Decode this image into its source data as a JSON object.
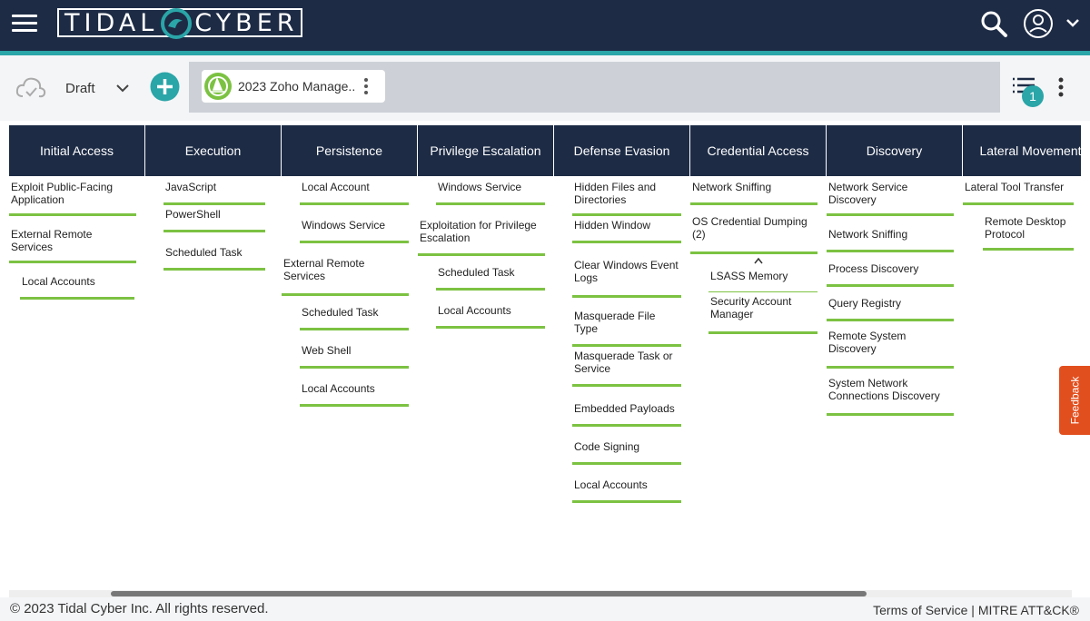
{
  "header": {
    "logo_left": "TIDAL",
    "logo_right": "CYBER"
  },
  "toolbar": {
    "status": "Draft",
    "tab_title": "2023 Zoho Manage...",
    "filter_count": "1"
  },
  "matrix": {
    "tactics": [
      {
        "name": "Initial Access",
        "techniques": [
          "Exploit Public-Facing Application",
          "External Remote Services",
          "Local Accounts"
        ]
      },
      {
        "name": "Execution",
        "techniques": [
          "JavaScript",
          "PowerShell",
          "Scheduled Task"
        ]
      },
      {
        "name": "Persistence",
        "techniques": [
          "Local Account",
          "Windows Service",
          "External Remote Services",
          "Scheduled Task",
          "Web Shell",
          "Local Accounts"
        ]
      },
      {
        "name": "Privilege Escalation",
        "techniques": [
          "Windows Service",
          "Exploitation for Privilege Escalation",
          "Scheduled Task",
          "Local Accounts"
        ]
      },
      {
        "name": "Defense Evasion",
        "techniques": [
          "Hidden Files and Directories",
          "Hidden Window",
          "Clear Windows Event Logs",
          "Masquerade File Type",
          "Masquerade Task or Service",
          "Embedded Payloads",
          "Code Signing",
          "Local Accounts"
        ]
      },
      {
        "name": "Credential Access",
        "techniques": [
          "Network Sniffing",
          "OS Credential Dumping (2)",
          "LSASS Memory",
          "Security Account Manager"
        ]
      },
      {
        "name": "Discovery",
        "techniques": [
          "Network Service Discovery",
          "Network Sniffing",
          "Process Discovery",
          "Query Registry",
          "Remote System Discovery",
          "System Network Connections Discovery"
        ]
      },
      {
        "name": "Lateral Movement",
        "techniques": [
          "Lateral Tool Transfer",
          "Remote Desktop Protocol"
        ]
      }
    ]
  },
  "footer": {
    "copyright": "© 2023 Tidal Cyber Inc. All rights reserved.",
    "terms": "Terms of Service",
    "separator": "|",
    "mitre": "MITRE ATT&CK®"
  },
  "feedback_label": "Feedback",
  "colors": {
    "navy": "#1d2b45",
    "teal": "#2aa5a8",
    "green": "#7cc242",
    "feedback": "#e24f1f"
  }
}
